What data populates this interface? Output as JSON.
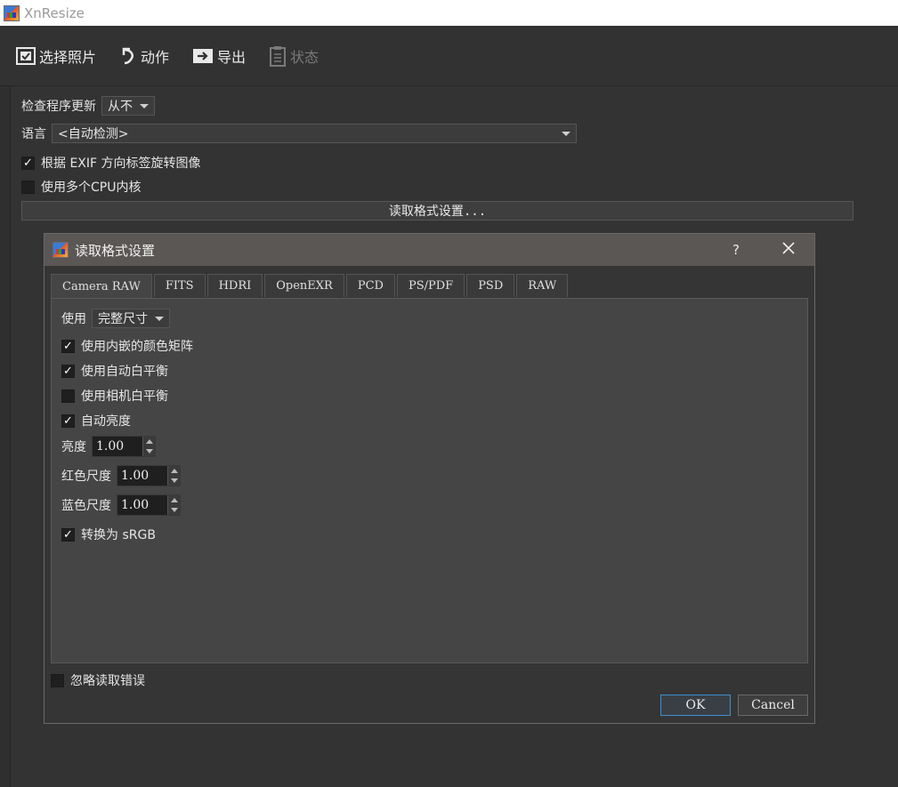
{
  "window": {
    "title": "XnResize"
  },
  "toolbar": {
    "select_photos": "选择照片",
    "actions": "动作",
    "export": "导出",
    "status": "状态"
  },
  "settings": {
    "check_updates_label": "检查程序更新",
    "check_updates_value": "从不",
    "language_label": "语言",
    "language_value": "<自动检测>",
    "exif_rotate_label": "根据 EXIF 方向标签旋转图像",
    "exif_rotate_checked": true,
    "multi_cpu_label": "使用多个CPU内核",
    "multi_cpu_checked": false,
    "read_format_button": "读取格式设置..."
  },
  "dialog": {
    "title": "读取格式设置",
    "help": "?",
    "tabs": [
      "Camera RAW",
      "FITS",
      "HDRI",
      "OpenEXR",
      "PCD",
      "PS/PDF",
      "PSD",
      "RAW"
    ],
    "active_tab": "Camera RAW",
    "use_label": "使用",
    "use_value": "完整尺寸",
    "options": {
      "embedded_matrix": {
        "label": "使用内嵌的颜色矩阵",
        "checked": true
      },
      "auto_wb": {
        "label": "使用自动白平衡",
        "checked": true
      },
      "camera_wb": {
        "label": "使用相机白平衡",
        "checked": false
      },
      "auto_brightness": {
        "label": "自动亮度",
        "checked": true
      },
      "to_srgb": {
        "label": "转换为 sRGB",
        "checked": true
      }
    },
    "brightness_label": "亮度",
    "brightness_value": "1.00",
    "red_scale_label": "红色尺度",
    "red_scale_value": "1.00",
    "blue_scale_label": "蓝色尺度",
    "blue_scale_value": "1.00",
    "ignore_errors_label": "忽略读取错误",
    "ignore_errors_checked": false,
    "ok_label": "OK",
    "cancel_label": "Cancel"
  },
  "colors": {
    "accent": "#3f8fd0",
    "background": "#2f2f2f",
    "dialog_title": "#5b5755"
  }
}
